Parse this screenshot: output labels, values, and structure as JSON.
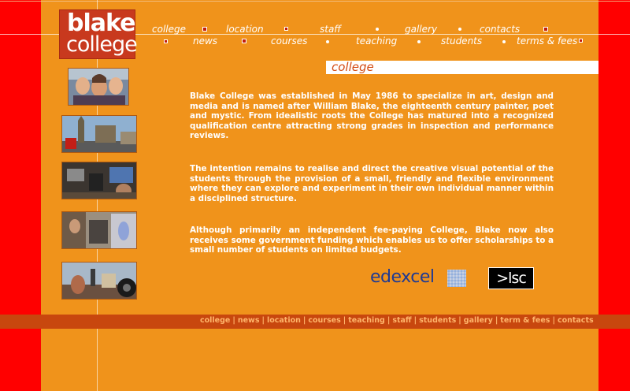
{
  "logo": {
    "line1": "blake",
    "line2": "college"
  },
  "nav_top": [
    "college",
    "location",
    "staff",
    "gallery",
    "contacts"
  ],
  "nav_bottom": [
    "news",
    "courses",
    "teaching",
    "students",
    "terms & fees"
  ],
  "section_title": "college",
  "paragraphs": [
    "Blake College was established in May 1986 to specialize in art, design and media and is named after William Blake, the eighteenth century painter, poet and mystic. From idealistic roots the College has matured into a recognized qualification centre attracting strong grades in inspection and performance reviews.",
    "The intention remains to realise and direct the creative visual potential of the students through the provision of a small, friendly and flexible environment where they can explore and experiment in their own individual manner within a disciplined structure.",
    "Although primarily an independent fee-paying College, Blake now also receives some government funding which enables us to offer scholarships to a small number of students on limited budgets."
  ],
  "partners": {
    "edexcel": "edexcel",
    "lsc": ">lsc"
  },
  "footer": [
    "college",
    "news",
    "location",
    "courses",
    "teaching",
    "staff",
    "students",
    "gallery",
    "term & fees",
    "contacts"
  ],
  "footer_sep": "|",
  "colors": {
    "page": "#f0931b",
    "sidebar": "#ff0000",
    "logo_bg": "#c8391e",
    "footer_bar": "#c8470e",
    "link": "#ffb56a"
  }
}
